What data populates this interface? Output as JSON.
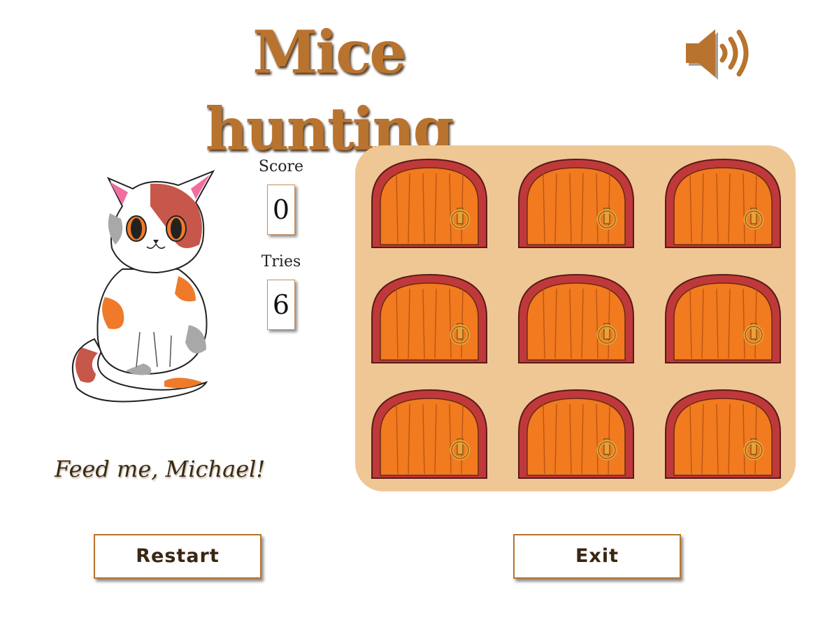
{
  "header": {
    "title": "Mice hunting"
  },
  "icons": {
    "sound": "speaker-volume-icon",
    "character": "calico-cat"
  },
  "stats": {
    "score_label": "Score",
    "score_value": "0",
    "tries_label": "Tries",
    "tries_value": "6"
  },
  "message": "Feed me, Michael!",
  "board": {
    "rows": 3,
    "columns": 3,
    "doors": 9
  },
  "buttons": {
    "restart": "Restart",
    "exit": "Exit"
  },
  "colors": {
    "title": "#b8732e",
    "board_background": "#efc795",
    "door_frame": "#c0393a",
    "door_wood": "#f27a1f",
    "door_ring": "#e8a23a",
    "button_border": "#b8732e"
  }
}
